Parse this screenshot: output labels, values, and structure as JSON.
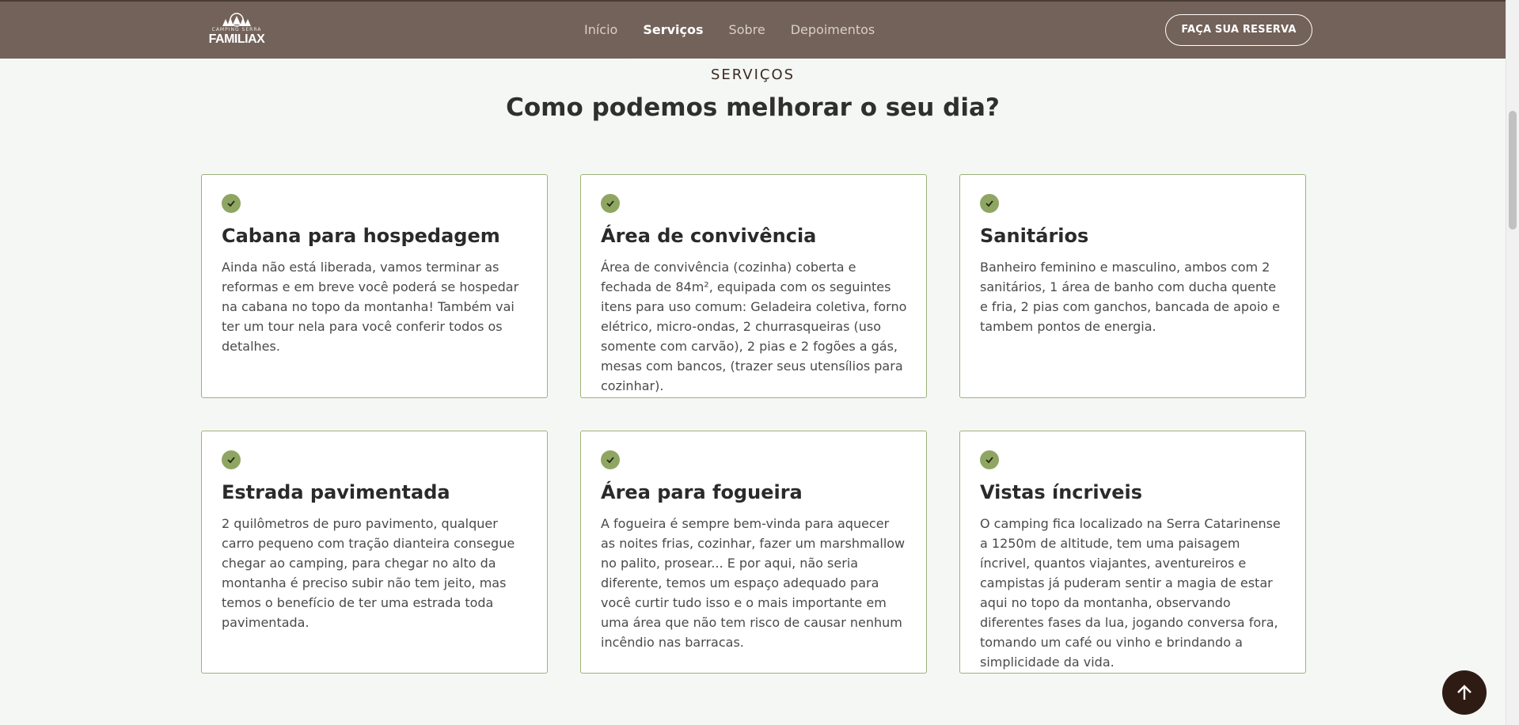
{
  "header": {
    "logo_small": "CAMPING SERRA",
    "logo_text": "FAMILIAX",
    "nav": [
      "Início",
      "Serviços",
      "Sobre",
      "Depoimentos"
    ],
    "cta_label": "FAÇA SUA RESERVA"
  },
  "section": {
    "eyebrow": "SERVIÇOS",
    "title": "Como podemos melhorar o seu dia?"
  },
  "cards": [
    {
      "title": "Cabana para hospedagem",
      "text": "Ainda não está liberada, vamos terminar as reformas e em breve você poderá se hospedar na cabana no topo da montanha! Também vai ter um tour nela para você conferir todos os detalhes."
    },
    {
      "title": "Área de convivência",
      "text": "Área de convivência (cozinha) coberta e fechada de 84m², equipada com os seguintes itens para uso comum: Geladeira coletiva, forno elétrico, micro-ondas, 2 churrasqueiras (uso somente com carvão), 2 pias e 2 fogões a gás, mesas com bancos, (trazer seus utensílios para cozinhar)."
    },
    {
      "title": "Sanitários",
      "text": "Banheiro feminino e masculino, ambos com 2 sanitários, 1 área de banho com ducha quente e fria, 2 pias com ganchos, bancada de apoio e tambem pontos de energia."
    },
    {
      "title": "Estrada pavimentada",
      "text": "2 quilômetros de puro pavimento, qualquer carro pequeno com tração dianteira consegue chegar ao camping, para chegar no alto da montanha é preciso subir não tem jeito, mas temos o benefício de ter uma estrada toda pavimentada."
    },
    {
      "title": "Área para fogueira",
      "text": "A fogueira é sempre bem-vinda para aquecer as noites frias, cozinhar, fazer um marshmallow no palito, prosear... E por aqui, não seria diferente, temos um espaço adequado para você curtir tudo isso e o mais importante em uma área que não tem risco de causar nenhum incêndio nas barracas."
    },
    {
      "title": "Vistas íncriveis",
      "text": "O camping fica localizado na Serra Catarinense a 1250m de altitude, tem uma paisagem íncrivel, quantos viajantes, aventureiros e campistas já puderam sentir a magia de estar aqui no topo da montanha, observando diferentes fases da lua, jogando conversa fora, tomando um café ou vinho e brindando a simplicidade da vida."
    }
  ],
  "colors": {
    "header_bg": "#73625a",
    "card_border": "#9cb27a",
    "check_bg": "#8fa663",
    "to_top_bg": "#2e1c14"
  },
  "icons": {
    "check": "check-icon",
    "to_top": "arrow-up-icon",
    "logo": "tent-logo-icon"
  }
}
